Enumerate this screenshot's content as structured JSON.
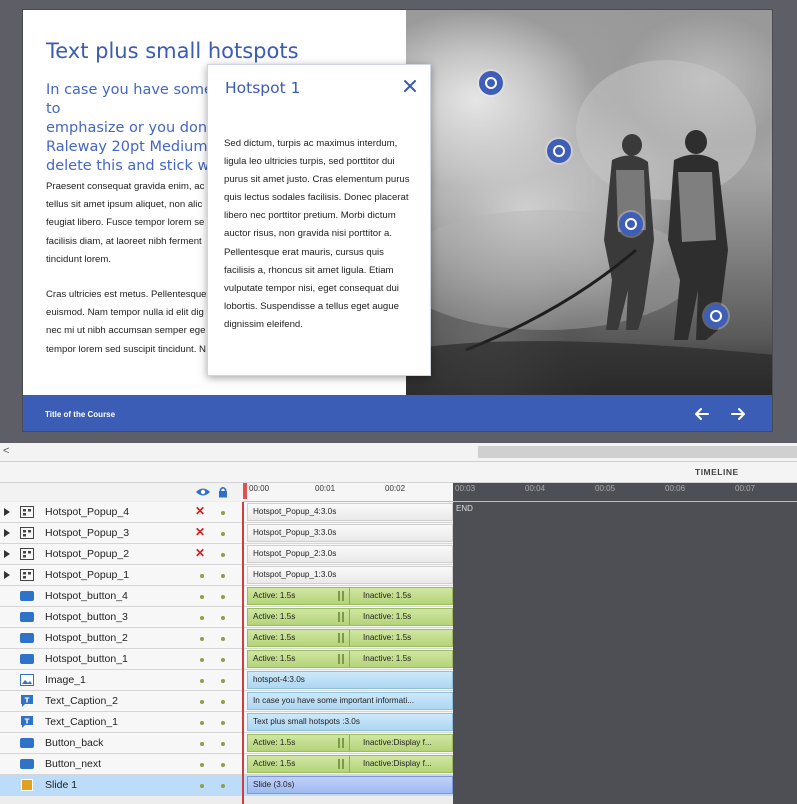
{
  "slide": {
    "title": "Text plus small hotspots",
    "subtitle": "In case you have some important information to\nemphasize or you don't\nRaleway 20pt Medium i\ndelete this and stick wit",
    "body_p1": "Praesent consequat gravida enim, ac\ntellus sit amet ipsum aliquet, non alic\nfeugiat libero. Fusce tempor lorem se\nfacilisis diam, at laoreet nibh ferment\ntincidunt lorem.",
    "body_p2": "Cras ultricies est metus. Pellentesque\neuismod. Nam tempor nulla id elit dig\nnec mi ut nibh accumsan semper ege\ntempor lorem sed suscipit tincidunt. N",
    "course_title": "Title of the Course",
    "popup": {
      "title": "Hotspot 1",
      "text": "Sed dictum, turpis ac maximus interdum,\nligula leo ultricies turpis, sed porttitor dui\npurus sit amet justo. Cras elementum purus\nquis lectus sodales facilisis. Donec placerat\nlibero nec porttitor pretium. Morbi dictum\nauctor risus, non gravida nisi porttitor a.\nPellentesque erat mauris, cursus quis\nfacilisis a, rhoncus sit amet ligula. Etiam\nvulputate tempor nisi, eget consequat dui\nlobortis. Suspendisse a tellus eget augue\ndignissim eleifend."
    }
  },
  "timeline": {
    "label": "TIMELINE",
    "ticks": [
      "00:00",
      "00:01",
      "00:02",
      "00:03",
      "00:04",
      "00:05",
      "00:06",
      "00:07"
    ],
    "end_label": "END",
    "rows": [
      {
        "name": "Hotspot_Popup_4",
        "bar": "Hotspot_Popup_4:3.0s"
      },
      {
        "name": "Hotspot_Popup_3",
        "bar": "Hotspot_Popup_3:3.0s"
      },
      {
        "name": "Hotspot_Popup_2",
        "bar": "Hotspot_Popup_2:3.0s"
      },
      {
        "name": "Hotspot_Popup_1",
        "bar": "Hotspot_Popup_1:3.0s"
      },
      {
        "name": "Hotspot_button_4",
        "active": "Active: 1.5s",
        "inactive": "Inactive: 1.5s"
      },
      {
        "name": "Hotspot_button_3",
        "active": "Active: 1.5s",
        "inactive": "Inactive: 1.5s"
      },
      {
        "name": "Hotspot_button_2",
        "active": "Active: 1.5s",
        "inactive": "Inactive: 1.5s"
      },
      {
        "name": "Hotspot_button_1",
        "active": "Active: 1.5s",
        "inactive": "Inactive: 1.5s"
      },
      {
        "name": "Image_1",
        "bar": "hotspot-4:3.0s"
      },
      {
        "name": "Text_Caption_2",
        "bar": "In case you have some important informati..."
      },
      {
        "name": "Text_Caption_1",
        "bar": "Text plus small hotspots  :3.0s"
      },
      {
        "name": "Button_back",
        "active": "Active: 1.5s",
        "inactive": "Inactive:Display f..."
      },
      {
        "name": "Button_next",
        "active": "Active: 1.5s",
        "inactive": "Inactive:Display f..."
      },
      {
        "name": "Slide 1",
        "bar": "Slide (3.0s)"
      }
    ]
  },
  "colors": {
    "accent": "#3c5db6",
    "hidden_mark": "#d02020",
    "active_bar": "#b4d478",
    "caption_bar": "#aed6f2",
    "slide_bar": "#9fb9f0"
  }
}
